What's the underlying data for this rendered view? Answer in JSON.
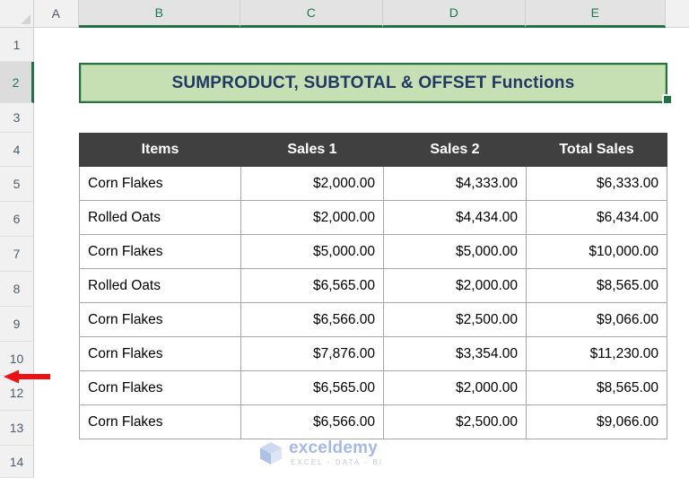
{
  "app": "excel-worksheet",
  "columns": [
    {
      "label": "A",
      "selected": false
    },
    {
      "label": "B",
      "selected": true
    },
    {
      "label": "C",
      "selected": true
    },
    {
      "label": "D",
      "selected": true
    },
    {
      "label": "E",
      "selected": true
    }
  ],
  "rows": [
    {
      "label": "1",
      "selected": false
    },
    {
      "label": "2",
      "selected": true
    },
    {
      "label": "3",
      "selected": false
    },
    {
      "label": "4",
      "selected": false
    },
    {
      "label": "5",
      "selected": false
    },
    {
      "label": "6",
      "selected": false
    },
    {
      "label": "7",
      "selected": false
    },
    {
      "label": "8",
      "selected": false
    },
    {
      "label": "9",
      "selected": false
    },
    {
      "label": "10",
      "selected": false
    },
    {
      "label": "12",
      "selected": false
    },
    {
      "label": "13",
      "selected": false
    },
    {
      "label": "14",
      "selected": false
    }
  ],
  "title_cell": {
    "text": "SUMPRODUCT, SUBTOTAL & OFFSET Functions",
    "fill_color": "#C6E0B4",
    "text_color": "#203864",
    "selection_color": "#217346"
  },
  "table": {
    "headers": [
      "Items",
      "Sales 1",
      "Sales 2",
      "Total Sales"
    ],
    "header_fill": "#404040",
    "header_text_color": "#FFFFFF",
    "rows": [
      {
        "item": "Corn Flakes",
        "sales1": "$2,000.00",
        "sales2": "$4,333.00",
        "total": "$6,333.00"
      },
      {
        "item": "Rolled Oats",
        "sales1": "$2,000.00",
        "sales2": "$4,434.00",
        "total": "$6,434.00"
      },
      {
        "item": "Corn Flakes",
        "sales1": "$5,000.00",
        "sales2": "$5,000.00",
        "total": "$10,000.00"
      },
      {
        "item": "Rolled Oats",
        "sales1": "$6,565.00",
        "sales2": "$2,000.00",
        "total": "$8,565.00"
      },
      {
        "item": "Corn Flakes",
        "sales1": "$6,566.00",
        "sales2": "$2,500.00",
        "total": "$9,066.00"
      },
      {
        "item": "Corn Flakes",
        "sales1": "$7,876.00",
        "sales2": "$3,354.00",
        "total": "$11,230.00"
      },
      {
        "item": "Corn Flakes",
        "sales1": "$6,565.00",
        "sales2": "$2,000.00",
        "total": "$8,565.00"
      },
      {
        "item": "Corn Flakes",
        "sales1": "$6,566.00",
        "sales2": "$2,500.00",
        "total": "$9,066.00"
      }
    ]
  },
  "annotation": {
    "icon": "left-arrow-icon",
    "color": "#EE1111"
  },
  "watermark": {
    "name": "exceldemy",
    "tagline": "EXCEL - DATA - BI",
    "name_color": "#9FB3E8",
    "tagline_color": "#B9C4D4"
  }
}
